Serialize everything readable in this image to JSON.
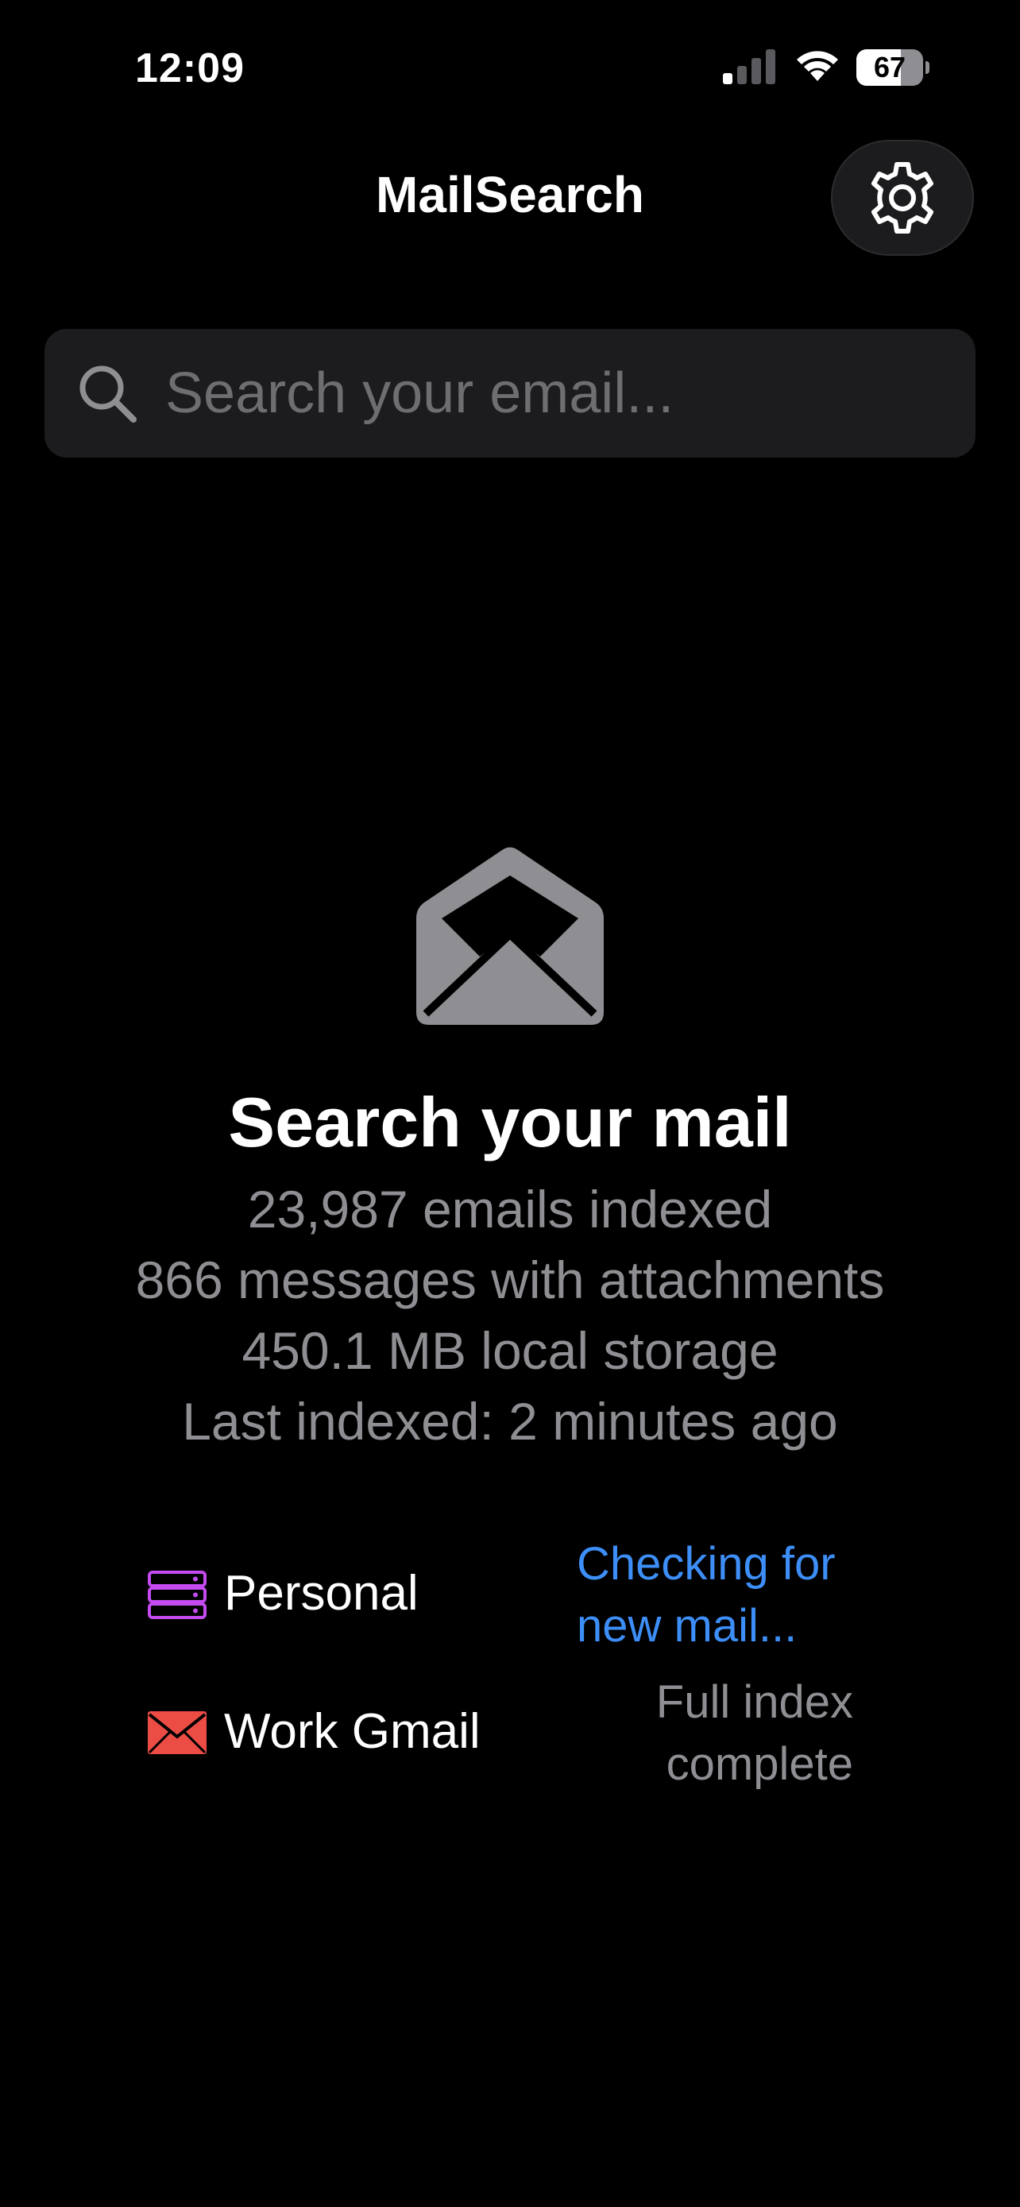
{
  "status_bar": {
    "time": "12:09",
    "battery_percent": "67",
    "battery_level": 0.67,
    "signal_bars_active": 1,
    "signal_bars_total": 4
  },
  "header": {
    "title": "MailSearch",
    "settings_icon": "gear-icon"
  },
  "search": {
    "placeholder": "Search your email...",
    "value": "",
    "icon": "search-icon"
  },
  "empty_state": {
    "icon": "envelope-open-icon",
    "title": "Search your mail",
    "stats": [
      "23,987 emails indexed",
      "866 messages with attachments",
      "450.1 MB local storage",
      "Last indexed: 2 minutes ago"
    ]
  },
  "accounts": [
    {
      "name": "Personal",
      "icon": "server-icon",
      "icon_color": "#c34bf0",
      "status": "Checking for\nnew mail...",
      "status_color": "#3d8ef7"
    },
    {
      "name": "Work Gmail",
      "icon": "envelope-icon",
      "icon_color": "#eb4d45",
      "status": "Full index\ncomplete",
      "status_color": "#8e8e93"
    }
  ],
  "colors": {
    "background": "#000000",
    "surface": "#1c1c1e",
    "secondary_text": "#8e8e93",
    "accent_blue": "#3d8ef7"
  }
}
